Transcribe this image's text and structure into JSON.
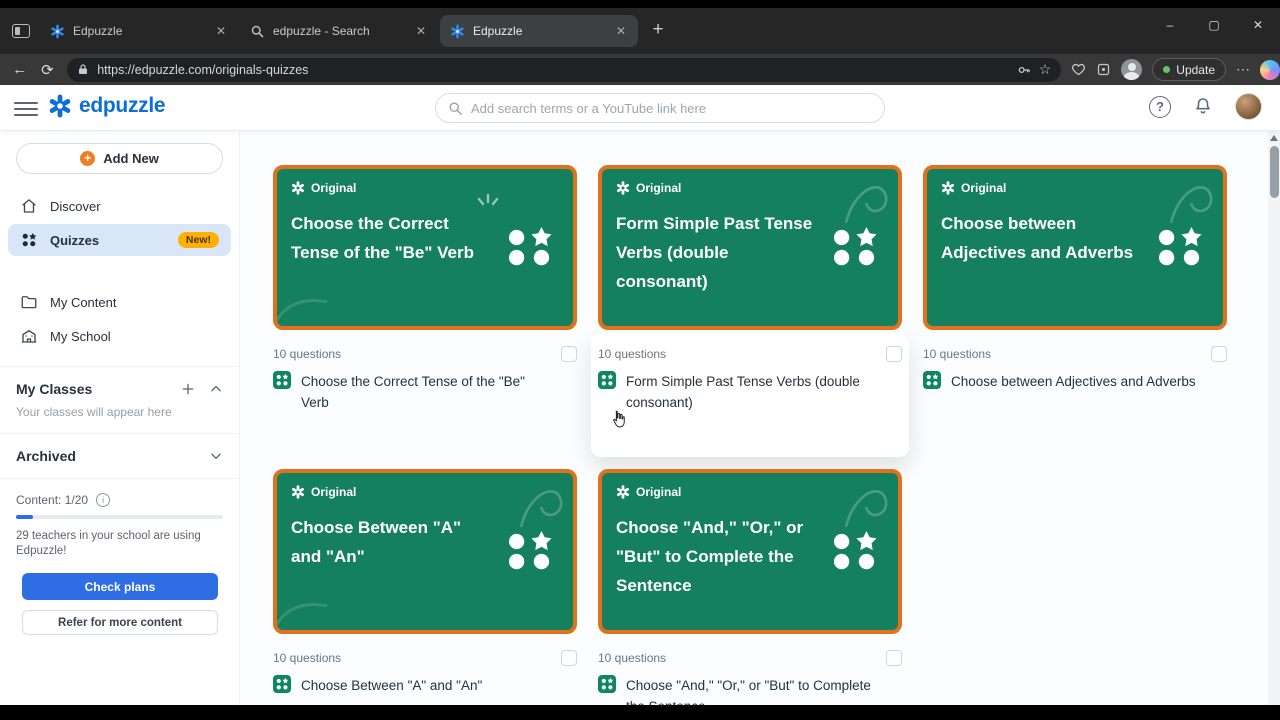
{
  "browser": {
    "tabs": [
      {
        "title": "Edpuzzle"
      },
      {
        "title": "edpuzzle - Search"
      },
      {
        "title": "Edpuzzle"
      }
    ],
    "url": "https://edpuzzle.com/originals-quizzes",
    "update_label": "Update"
  },
  "header": {
    "brand": "edpuzzle",
    "search_placeholder": "Add search terms or a YouTube link here"
  },
  "sidebar": {
    "add_new": "Add New",
    "items": [
      {
        "label": "Discover"
      },
      {
        "label": "Quizzes",
        "badge": "New!"
      },
      {
        "label": "My Content"
      },
      {
        "label": "My School"
      }
    ],
    "my_classes": {
      "title": "My Classes",
      "empty": "Your classes will appear here"
    },
    "archived": "Archived",
    "content_label": "Content: 1/20",
    "teachers_note": "29 teachers in your school are using Edpuzzle!",
    "check_plans": "Check plans",
    "refer": "Refer for more content"
  },
  "main": {
    "badge": "Original",
    "cards": [
      {
        "title": "Choose the Correct Tense of the \"Be\" Verb",
        "questions": "10 questions",
        "list_title": "Choose the Correct Tense of the \"Be\" Verb"
      },
      {
        "title": "Form Simple Past Tense Verbs (double consonant)",
        "questions": "10 questions",
        "list_title": "Form Simple Past Tense Verbs (double consonant)"
      },
      {
        "title": "Choose between Adjectives and Adverbs",
        "questions": "10 questions",
        "list_title": "Choose between Adjectives and Adverbs"
      },
      {
        "title": "Choose Between \"A\" and \"An\"",
        "questions": "10 questions",
        "list_title": "Choose Between \"A\" and \"An\""
      },
      {
        "title": "Choose \"And,\" \"Or,\" or \"But\" to Complete the Sentence",
        "questions": "10 questions",
        "list_title": "Choose \"And,\" \"Or,\" or \"But\" to Complete the Sentence"
      }
    ]
  },
  "colors": {
    "card_green": "#15805e",
    "card_border_orange": "#e0711f",
    "brand_blue": "#0d6ed6",
    "new_badge_orange": "#ffb001",
    "primary_button_blue": "#2e6de3"
  }
}
